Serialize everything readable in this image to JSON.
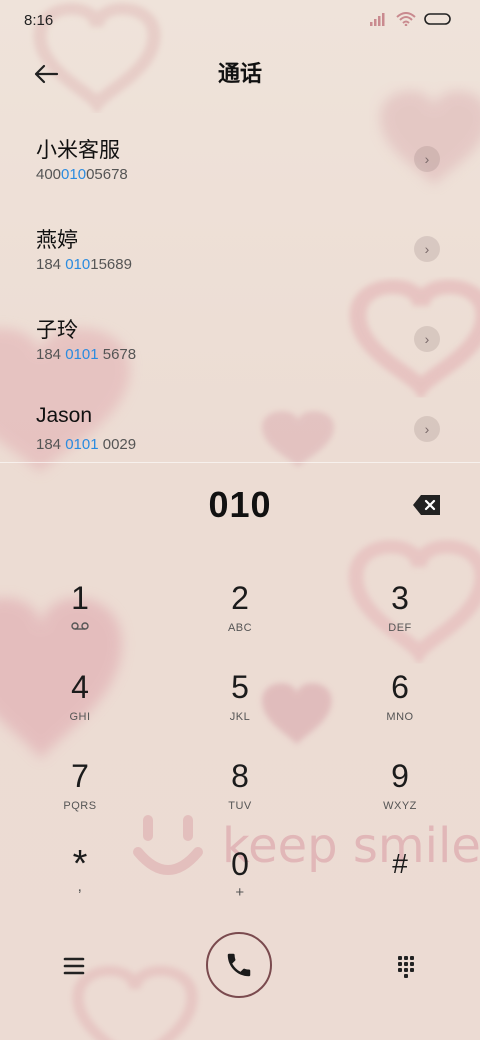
{
  "status": {
    "time": "8:16"
  },
  "header": {
    "title": "通话"
  },
  "results": [
    {
      "name": "小米客服",
      "num_pre": "400",
      "num_hl": "010",
      "num_post": "05678"
    },
    {
      "name": "燕婷",
      "num_pre": "184 ",
      "num_hl": "010",
      "num_post": "15689"
    },
    {
      "name": "子玲",
      "num_pre": "184 ",
      "num_hl": "0101",
      "num_post": " 5678"
    },
    {
      "name": "Jason",
      "num_pre": "184 ",
      "num_hl": "0101",
      "num_post": " 0029"
    }
  ],
  "dialer": {
    "input": "010"
  },
  "keypad": [
    {
      "digit": "1",
      "letters": ""
    },
    {
      "digit": "2",
      "letters": "ABC"
    },
    {
      "digit": "3",
      "letters": "DEF"
    },
    {
      "digit": "4",
      "letters": "GHI"
    },
    {
      "digit": "5",
      "letters": "JKL"
    },
    {
      "digit": "6",
      "letters": "MNO"
    },
    {
      "digit": "7",
      "letters": "PQRS"
    },
    {
      "digit": "8",
      "letters": "TUV"
    },
    {
      "digit": "9",
      "letters": "WXYZ"
    },
    {
      "digit": "*",
      "letters": ","
    },
    {
      "digit": "0",
      "letters": "+"
    },
    {
      "digit": "#",
      "letters": ""
    }
  ],
  "wallpaper": {
    "text": "keep smile"
  },
  "colors": {
    "highlight": "#2a8be0",
    "call_ring": "#7a4a4e"
  }
}
